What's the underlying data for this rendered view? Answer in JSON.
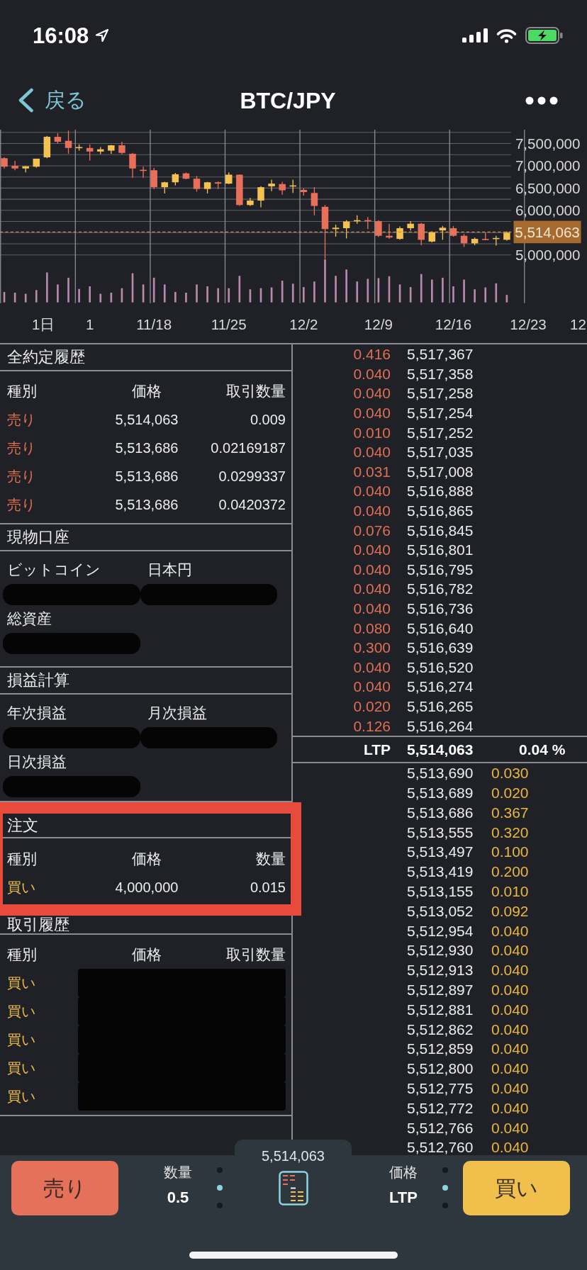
{
  "status_bar": {
    "time": "16:08"
  },
  "header": {
    "back_label": "戻る",
    "title": "BTC/JPY"
  },
  "chart": {
    "interval": "1日",
    "chart_data": {
      "type": "candlestick",
      "categories": [
        null,
        null,
        null,
        null,
        null,
        null,
        null,
        null,
        "1",
        null,
        null,
        null,
        null,
        null,
        "11/18",
        null,
        null,
        null,
        null,
        null,
        null,
        "11/25",
        null,
        null,
        null,
        null,
        null,
        null,
        "12/2",
        null,
        null,
        null,
        null,
        null,
        null,
        "12/9",
        null,
        null,
        null,
        null,
        null,
        null,
        "12/16",
        null,
        null,
        null,
        null,
        null,
        null,
        "12/23",
        null,
        null,
        null,
        null,
        "12"
      ],
      "ohlc": [
        [
          7170000,
          7190000,
          6940000,
          6980000
        ],
        [
          7000000,
          7110000,
          6900000,
          6940000
        ],
        [
          6940000,
          6990000,
          6850000,
          6990000
        ],
        [
          6980000,
          7160000,
          6960000,
          7160000
        ],
        [
          7190000,
          7670000,
          7170000,
          7650000
        ],
        [
          7650000,
          7730000,
          7500000,
          7540000
        ],
        [
          7560000,
          7790000,
          7270000,
          7400000
        ],
        [
          7400000,
          7480000,
          7340000,
          7420000
        ],
        [
          7400000,
          7480000,
          7120000,
          7320000
        ],
        [
          7320000,
          7420000,
          7260000,
          7370000
        ],
        [
          7340000,
          7470000,
          7270000,
          7460000
        ],
        [
          7460000,
          7540000,
          7260000,
          7290000
        ],
        [
          7270000,
          7290000,
          6730000,
          6940000
        ],
        [
          6910000,
          6980000,
          6730000,
          6890000
        ],
        [
          6900000,
          6950000,
          6480000,
          6520000
        ],
        [
          6520000,
          6640000,
          6380000,
          6630000
        ],
        [
          6630000,
          6840000,
          6560000,
          6810000
        ],
        [
          6830000,
          6850000,
          6700000,
          6710000
        ],
        [
          6710000,
          6770000,
          6420000,
          6480000
        ],
        [
          6480000,
          6640000,
          6380000,
          6630000
        ],
        [
          6630000,
          6650000,
          6480000,
          6600000
        ],
        [
          6600000,
          6850000,
          6590000,
          6800000
        ],
        [
          6800000,
          6810000,
          6100000,
          6120000
        ],
        [
          6120000,
          6280000,
          6100000,
          6220000
        ],
        [
          6220000,
          6540000,
          6070000,
          6520000
        ],
        [
          6540000,
          6690000,
          6430000,
          6600000
        ],
        [
          6590000,
          6640000,
          6350000,
          6450000
        ],
        [
          6540000,
          6690000,
          6390000,
          6560000
        ],
        [
          6460000,
          6490000,
          6330000,
          6410000
        ],
        [
          6390000,
          6520000,
          5890000,
          6100000
        ],
        [
          6080000,
          6120000,
          4910000,
          5580000
        ],
        [
          5580000,
          5680000,
          5410000,
          5610000
        ],
        [
          5600000,
          5780000,
          5370000,
          5750000
        ],
        [
          5760000,
          5890000,
          5700000,
          5780000
        ],
        [
          5780000,
          5850000,
          5580000,
          5760000
        ],
        [
          5760000,
          5780000,
          5400000,
          5430000
        ],
        [
          5430000,
          5700000,
          5360000,
          5390000
        ],
        [
          5360000,
          5640000,
          5340000,
          5600000
        ],
        [
          5600000,
          5760000,
          5550000,
          5700000
        ],
        [
          5700000,
          5720000,
          5220000,
          5340000
        ],
        [
          5300000,
          5530000,
          5280000,
          5510000
        ],
        [
          5550000,
          5650000,
          5340000,
          5610000
        ],
        [
          5600000,
          5650000,
          5410000,
          5430000
        ],
        [
          5430000,
          5470000,
          5180000,
          5260000
        ],
        [
          5260000,
          5390000,
          5220000,
          5360000
        ],
        [
          5360000,
          5500000,
          5330000,
          5340000
        ],
        [
          5360000,
          5430000,
          5210000,
          5380000
        ],
        [
          5340000,
          5530000,
          5320000,
          5500000
        ],
        null,
        null,
        null,
        null,
        null,
        null,
        null
      ],
      "ylim": [
        3935000,
        7810000
      ],
      "yticks": [
        {
          "value": 7500000,
          "label": "7,500,000"
        },
        {
          "value": 7000000,
          "label": "7,000,000"
        },
        {
          "value": 6500000,
          "label": "6,500,000"
        },
        {
          "value": 6000000,
          "label": "6,000,000"
        },
        {
          "value": 5000000,
          "label": "5,000,000"
        }
      ],
      "grid": true,
      "ref_lines": [
        {
          "axis": "y",
          "value": 5514063
        }
      ],
      "annotations": [
        "5,514,063"
      ]
    }
  },
  "executions": {
    "title": "全約定履歴",
    "columns": [
      "種別",
      "価格",
      "取引数量"
    ],
    "rows": [
      {
        "kind": "sell",
        "type": "売り",
        "price": "5,514,063",
        "amount": "0.009"
      },
      {
        "kind": "sell",
        "type": "売り",
        "price": "5,513,686",
        "amount": "0.02169187"
      },
      {
        "kind": "sell",
        "type": "売り",
        "price": "5,513,686",
        "amount": "0.0299337"
      },
      {
        "kind": "sell",
        "type": "売り",
        "price": "5,513,686",
        "amount": "0.0420372"
      }
    ]
  },
  "spot_account": {
    "title": "現物口座",
    "fields": [
      {
        "label": "ビットコイン",
        "redacted": true
      },
      {
        "label": "日本円",
        "redacted": true
      },
      {
        "label": "総資産",
        "redacted": true
      }
    ]
  },
  "profit_loss": {
    "title": "損益計算",
    "fields": [
      {
        "label": "年次損益",
        "redacted": true
      },
      {
        "label": "月次損益",
        "redacted": true
      },
      {
        "label": "日次損益",
        "redacted": true
      }
    ]
  },
  "orders": {
    "title": "注文",
    "highlighted": true,
    "columns": [
      "種別",
      "価格",
      "数量"
    ],
    "rows": [
      {
        "kind": "buy",
        "type": "買い",
        "price": "4,000,000",
        "amount": "0.015"
      }
    ]
  },
  "trade_history": {
    "title": "取引履歴",
    "columns": [
      "種別",
      "価格",
      "取引数量"
    ],
    "rows": [
      {
        "kind": "buy",
        "type": "買い",
        "redacted": true
      },
      {
        "kind": "buy",
        "type": "買い",
        "redacted": true
      },
      {
        "kind": "buy",
        "type": "買い",
        "redacted": true
      },
      {
        "kind": "buy",
        "type": "買い",
        "redacted": true
      },
      {
        "kind": "buy",
        "type": "買い",
        "redacted": true
      }
    ]
  },
  "order_book": {
    "asks": [
      {
        "amount": "0.416",
        "price": "5,517,367"
      },
      {
        "amount": "0.040",
        "price": "5,517,358"
      },
      {
        "amount": "0.040",
        "price": "5,517,258"
      },
      {
        "amount": "0.040",
        "price": "5,517,254"
      },
      {
        "amount": "0.010",
        "price": "5,517,252"
      },
      {
        "amount": "0.040",
        "price": "5,517,035"
      },
      {
        "amount": "0.031",
        "price": "5,517,008"
      },
      {
        "amount": "0.040",
        "price": "5,516,888"
      },
      {
        "amount": "0.040",
        "price": "5,516,865"
      },
      {
        "amount": "0.076",
        "price": "5,516,845"
      },
      {
        "amount": "0.040",
        "price": "5,516,801"
      },
      {
        "amount": "0.040",
        "price": "5,516,795"
      },
      {
        "amount": "0.040",
        "price": "5,516,782"
      },
      {
        "amount": "0.040",
        "price": "5,516,736"
      },
      {
        "amount": "0.080",
        "price": "5,516,640"
      },
      {
        "amount": "0.300",
        "price": "5,516,639"
      },
      {
        "amount": "0.040",
        "price": "5,516,520"
      },
      {
        "amount": "0.040",
        "price": "5,516,274"
      },
      {
        "amount": "0.020",
        "price": "5,516,265"
      },
      {
        "amount": "0.126",
        "price": "5,516,264"
      }
    ],
    "ltp": {
      "label": "LTP",
      "price": "5,514,063",
      "change": "0.04 %"
    },
    "bids": [
      {
        "price": "5,513,690",
        "amount": "0.030"
      },
      {
        "price": "5,513,689",
        "amount": "0.020"
      },
      {
        "price": "5,513,686",
        "amount": "0.367"
      },
      {
        "price": "5,513,555",
        "amount": "0.320"
      },
      {
        "price": "5,513,497",
        "amount": "0.100"
      },
      {
        "price": "5,513,419",
        "amount": "0.200"
      },
      {
        "price": "5,513,155",
        "amount": "0.010"
      },
      {
        "price": "5,513,052",
        "amount": "0.092"
      },
      {
        "price": "5,512,954",
        "amount": "0.040"
      },
      {
        "price": "5,512,930",
        "amount": "0.040"
      },
      {
        "price": "5,512,913",
        "amount": "0.040"
      },
      {
        "price": "5,512,897",
        "amount": "0.040"
      },
      {
        "price": "5,512,881",
        "amount": "0.040"
      },
      {
        "price": "5,512,862",
        "amount": "0.040"
      },
      {
        "price": "5,512,859",
        "amount": "0.040"
      },
      {
        "price": "5,512,800",
        "amount": "0.040"
      },
      {
        "price": "5,512,775",
        "amount": "0.040"
      },
      {
        "price": "5,512,772",
        "amount": "0.040"
      },
      {
        "price": "5,512,766",
        "amount": "0.040"
      },
      {
        "price": "5,512,760",
        "amount": "0.040"
      }
    ]
  },
  "toolbar": {
    "sell_label": "売り",
    "buy_label": "買い",
    "last_price": "5,514,063",
    "quantity": {
      "label": "数量",
      "value": "0.5",
      "steps": [
        {
          "selected": false
        },
        {
          "selected": true
        },
        {
          "selected": false
        }
      ]
    },
    "price_type": {
      "label": "価格",
      "value": "LTP",
      "steps": [
        {
          "selected": false
        },
        {
          "selected": true
        },
        {
          "selected": false
        }
      ]
    }
  }
}
